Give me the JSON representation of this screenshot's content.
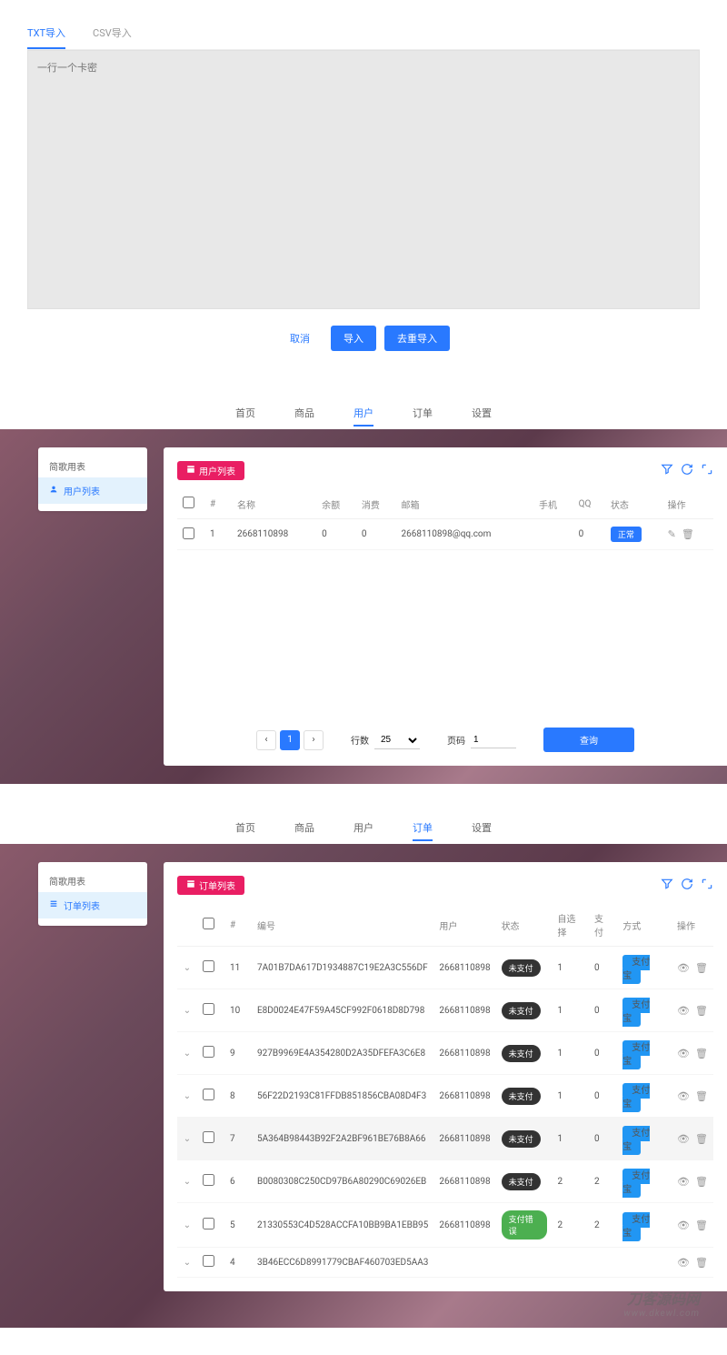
{
  "s1": {
    "tabs": [
      "TXT导入",
      "CSV导入"
    ],
    "placeholder": "一行一个卡密",
    "buttons": {
      "cancel": "取消",
      "import": "导入",
      "importReset": "去重导入"
    }
  },
  "nav": {
    "items": [
      "首页",
      "商品",
      "用户",
      "订单",
      "设置"
    ]
  },
  "s2": {
    "sidebar": {
      "title": "简歌用表",
      "item": "用户列表"
    },
    "tag": "用户列表",
    "headers": [
      "#",
      "名称",
      "余额",
      "消费",
      "邮箱",
      "手机",
      "QQ",
      "状态",
      "操作"
    ],
    "row": {
      "n": "1",
      "name": "2668110898",
      "bal": "0",
      "spend": "0",
      "email": "2668110898@qq.com",
      "phone": "",
      "qq": "0",
      "status": "正常"
    },
    "pager": {
      "rowsLabel": "行数",
      "rows": "25",
      "pageLabel": "页码",
      "page": "1",
      "query": "查询"
    }
  },
  "s3": {
    "sidebar": {
      "title": "简歌用表",
      "item": "订单列表"
    },
    "tag": "订单列表",
    "headers": [
      "#",
      "编号",
      "用户",
      "状态",
      "自选择",
      "支付",
      "方式",
      "操作"
    ],
    "rows": [
      {
        "n": "11",
        "code": "7A01B7DA617D1934887C19E2A3C556DF",
        "user": "2668110898",
        "status": "未支付",
        "statusType": "dark",
        "a": "1",
        "b": "0",
        "mode": "支付宝"
      },
      {
        "n": "10",
        "code": "E8D0024E47F59A45CF992F0618D8D798",
        "user": "2668110898",
        "status": "未支付",
        "statusType": "dark",
        "a": "1",
        "b": "0",
        "mode": "支付宝"
      },
      {
        "n": "9",
        "code": "927B9969E4A354280D2A35DFEFA3C6E8",
        "user": "2668110898",
        "status": "未支付",
        "statusType": "dark",
        "a": "1",
        "b": "0",
        "mode": "支付宝"
      },
      {
        "n": "8",
        "code": "56F22D2193C81FFDB851856CBA08D4F3",
        "user": "2668110898",
        "status": "未支付",
        "statusType": "dark",
        "a": "1",
        "b": "0",
        "mode": "支付宝"
      },
      {
        "n": "7",
        "code": "5A364B98443B92F2A2BF961BE76B8A66",
        "user": "2668110898",
        "status": "未支付",
        "statusType": "dark",
        "a": "1",
        "b": "0",
        "mode": "支付宝",
        "hover": true
      },
      {
        "n": "6",
        "code": "B0080308C250CD97B6A80290C69026EB",
        "user": "2668110898",
        "status": "未支付",
        "statusType": "dark",
        "a": "2",
        "b": "2",
        "mode": "支付宝"
      },
      {
        "n": "5",
        "code": "21330553C4D528ACCFA10BB9BA1EBB95",
        "user": "2668110898",
        "status": "支付错误",
        "statusType": "green",
        "a": "2",
        "b": "2",
        "mode": "支付宝"
      },
      {
        "n": "4",
        "code": "3B46ECC6D8991779CBAF460703ED5AA3",
        "user": "",
        "status": "",
        "statusType": "",
        "a": "",
        "b": "",
        "mode": ""
      }
    ]
  },
  "watermark": {
    "cn": "刀客源码网",
    "en": "www.dkewl.com"
  }
}
